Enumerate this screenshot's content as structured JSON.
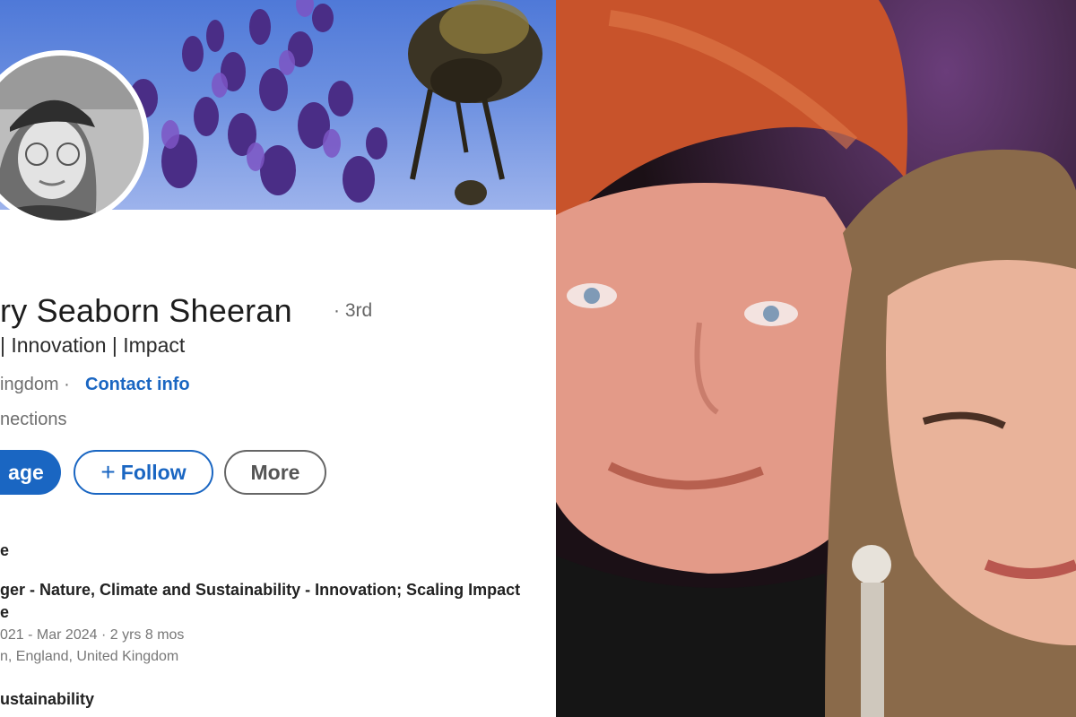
{
  "profile": {
    "name": "ry Seaborn Sheeran",
    "degree": "· 3rd",
    "headline": "| Innovation | Impact",
    "location": "ingdom ·",
    "contact_info": "Contact info",
    "connections": "nections",
    "buttons": {
      "message": "age",
      "follow": "Follow",
      "follow_icon": "plus-icon",
      "more": "More"
    },
    "experience": {
      "section_label": "e",
      "title_line1": "ger - Nature, Climate and Sustainability - Innovation; Scaling Impact",
      "title_line2": "e",
      "dates": "021 - Mar 2024 · 2 yrs 8 mos",
      "location": "n, England, United Kingdom",
      "next_item": "ustainability"
    }
  },
  "colors": {
    "linkedin_blue": "#1a66c2",
    "banner_sky": "#5b82dc",
    "lavender": "#5b3a9a"
  }
}
